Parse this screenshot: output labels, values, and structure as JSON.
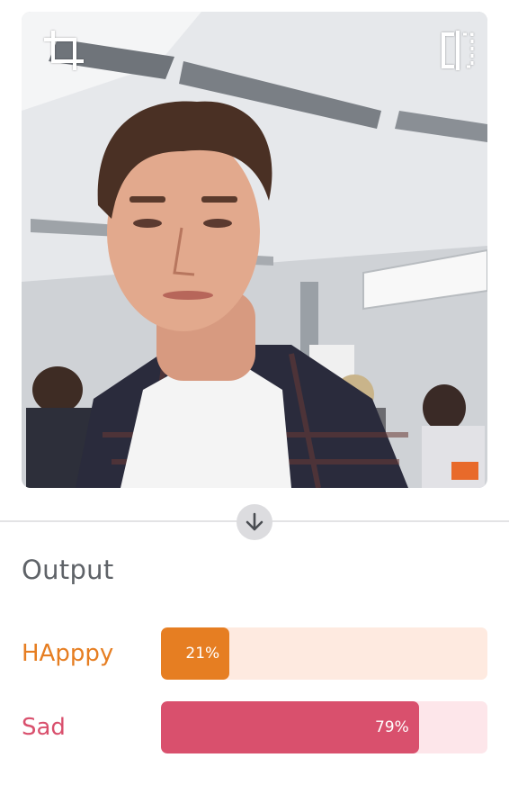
{
  "webcam": {
    "crop_icon": "crop-icon",
    "flip_icon": "flip-horizontal-icon"
  },
  "divider": {
    "arrow_icon": "arrow-down-icon"
  },
  "output": {
    "title": "Output",
    "classes": [
      {
        "label": "HApppy",
        "percent_text": "21%",
        "confidence": 0.21,
        "color": "#e67e22",
        "track_color": "#feeae0"
      },
      {
        "label": "Sad",
        "percent_text": "79%",
        "confidence": 0.79,
        "color": "#d9506d",
        "track_color": "#fde6ea"
      }
    ]
  }
}
